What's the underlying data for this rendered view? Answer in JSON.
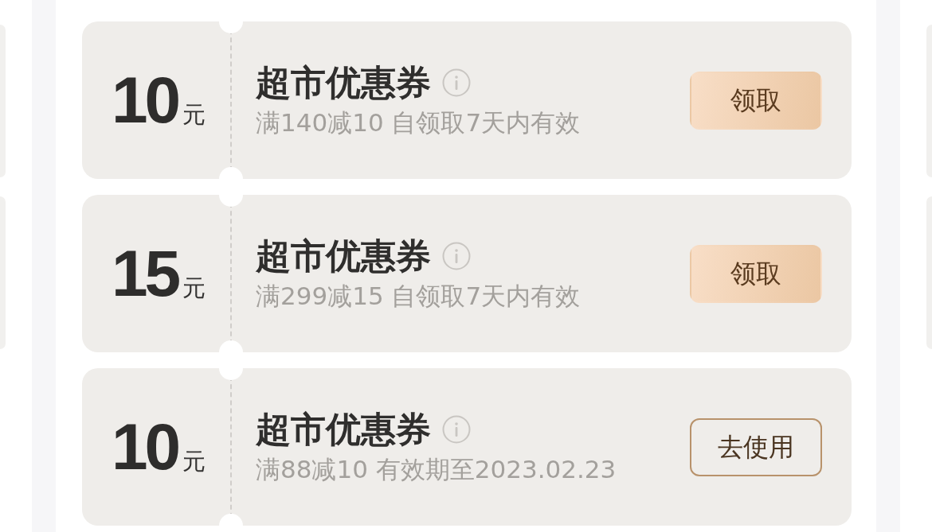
{
  "coupons": [
    {
      "amount": "10",
      "unit": "元",
      "title": "超市优惠券",
      "condition": "满140减10 自领取7天内有效",
      "action": {
        "kind": "claim",
        "label": "领取"
      }
    },
    {
      "amount": "15",
      "unit": "元",
      "title": "超市优惠券",
      "condition": "满299减15 自领取7天内有效",
      "action": {
        "kind": "claim",
        "label": "领取"
      }
    },
    {
      "amount": "10",
      "unit": "元",
      "title": "超市优惠券",
      "condition": "满88减10 有效期至2023.02.23",
      "action": {
        "kind": "use",
        "label": "去使用"
      }
    }
  ]
}
